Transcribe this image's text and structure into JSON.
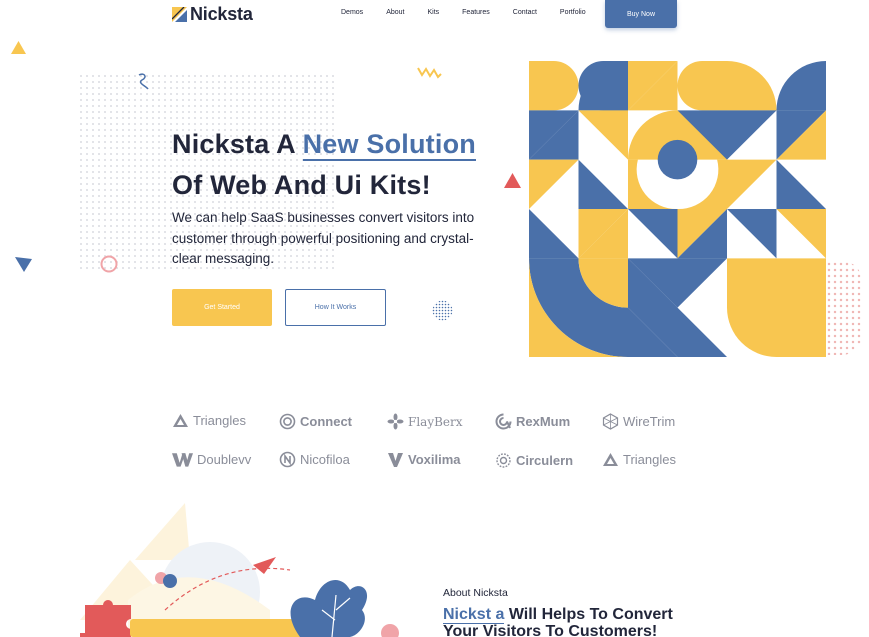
{
  "header": {
    "logo_text": "Nicksta",
    "logo_dot": ".",
    "nav": [
      "Demos",
      "About",
      "Kits",
      "Features",
      "Contact",
      "Portfolio"
    ],
    "buy_label": "Buy Now"
  },
  "hero": {
    "title_part1": "Nicksta A ",
    "title_accent": "New Solution",
    "title_line2": "Of Web And Ui Kits!",
    "subtitle": "We can help SaaS businesses convert visitors into customer through powerful positioning and crystal-clear messaging.",
    "primary_label": "Get Started",
    "secondary_label": "How It Works"
  },
  "brands": [
    {
      "name": "Triangles",
      "icon": "triangles-logo-icon"
    },
    {
      "name": "Connect",
      "icon": "connect-logo-icon"
    },
    {
      "name": "FlayBerx",
      "icon": "flayberx-logo-icon"
    },
    {
      "name": "RexMum",
      "icon": "rexmum-logo-icon"
    },
    {
      "name": "WireTrim",
      "icon": "wiretrim-logo-icon"
    },
    {
      "name": "Doublevv",
      "icon": "doublevv-logo-icon"
    },
    {
      "name": "Nicofiloa",
      "icon": "nicofiloa-logo-icon"
    },
    {
      "name": "Voxilima",
      "icon": "voxilima-logo-icon"
    },
    {
      "name": "Circulern",
      "icon": "circulern-logo-icon"
    },
    {
      "name": "Triangles",
      "icon": "triangles-logo-icon"
    }
  ],
  "about": {
    "kicker": "About Nicksta",
    "title_accent": "Nickst a",
    "title_rest": " Will Helps To Convert",
    "title_line2": "Your Visitors To Customers!"
  },
  "colors": {
    "blue": "#4a70a9",
    "yellow": "#f8c650",
    "red": "#e25a5a",
    "dark": "#22263a"
  }
}
